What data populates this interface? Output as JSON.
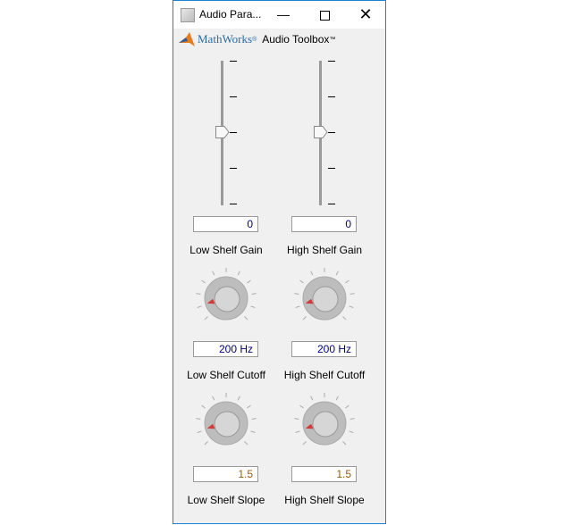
{
  "window": {
    "title": "Audio Para...",
    "minimize_icon": "minimize-icon",
    "maximize_icon": "maximize-icon",
    "close_icon": "close-icon"
  },
  "brand": {
    "mathworks": "MathWorks",
    "registered": "®",
    "toolbox": "Audio Toolbox",
    "tm": "™"
  },
  "controls": [
    {
      "label": "Low Shelf Gain",
      "type": "slider",
      "value": "0",
      "fraction": 0.5
    },
    {
      "label": "High Shelf Gain",
      "type": "slider",
      "value": "0",
      "fraction": 0.5
    },
    {
      "label": "Low Shelf Cutoff",
      "type": "knob",
      "value": "200 Hz",
      "fraction": 0.0
    },
    {
      "label": "High Shelf Cutoff",
      "type": "knob",
      "value": "200 Hz",
      "fraction": 0.0
    },
    {
      "label": "Low Shelf Slope",
      "type": "knob",
      "value": "1.5",
      "fraction": 0.0
    },
    {
      "label": "High Shelf Slope",
      "type": "knob",
      "value": "1.5",
      "fraction": 0.0
    }
  ],
  "colors": {
    "value_blue": "#00007f",
    "value_orange": "#a05a00",
    "accent": "#1883d7",
    "indicator": "#d62a2a"
  }
}
